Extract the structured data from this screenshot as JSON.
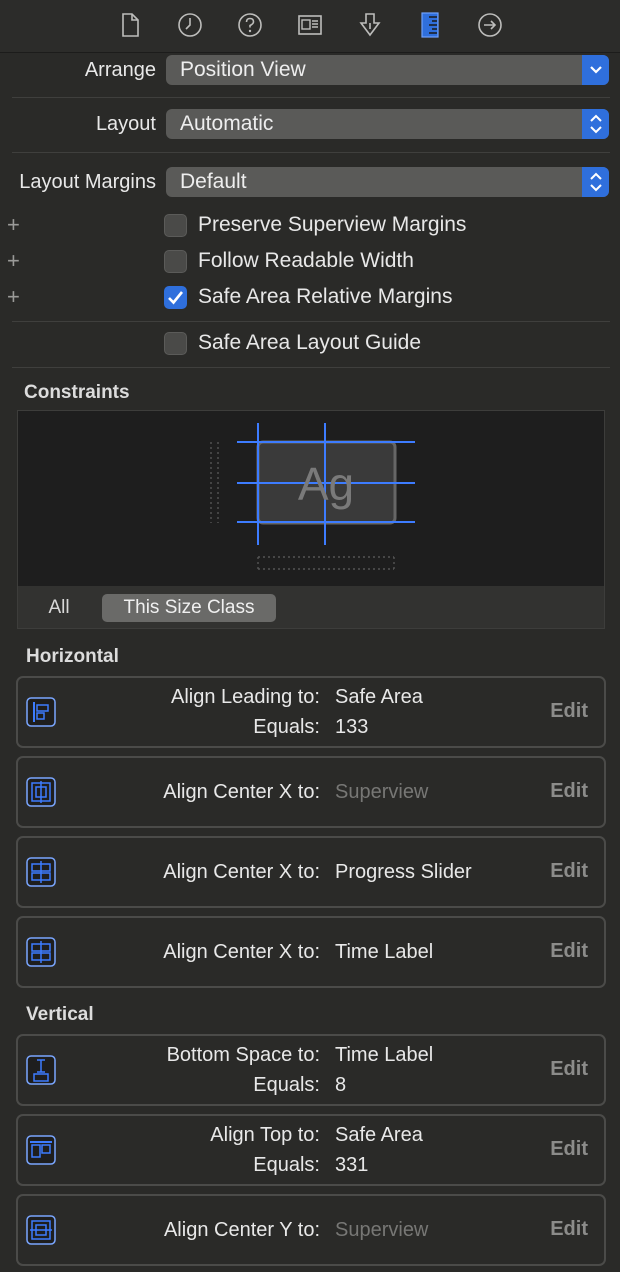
{
  "toolbar": {
    "icons": [
      "file-icon",
      "history-icon",
      "help-icon",
      "identity-icon",
      "attributes-icon",
      "size-ruler-icon",
      "connections-icon"
    ],
    "selected": "size-ruler-icon",
    "accent": "#2f6fdc"
  },
  "arrange": {
    "label": "Arrange",
    "value": "Position View"
  },
  "layout": {
    "label": "Layout",
    "value": "Automatic"
  },
  "layout_margins": {
    "label": "Layout Margins",
    "value": "Default"
  },
  "checkboxes": [
    {
      "label": "Preserve Superview Margins",
      "checked": false,
      "plus": "+"
    },
    {
      "label": "Follow Readable Width",
      "checked": false,
      "plus": "+"
    },
    {
      "label": "Safe Area Relative Margins",
      "checked": true,
      "plus": "+"
    },
    {
      "label": "Safe Area Layout Guide",
      "checked": false
    }
  ],
  "constraints": {
    "title": "Constraints",
    "preview_text": "Ag",
    "segments": [
      "All",
      "This Size Class"
    ],
    "selected_segment": "This Size Class"
  },
  "horizontal": {
    "title": "Horizontal",
    "rows": [
      {
        "icon": "align-leading-icon",
        "key": "Align Leading to:",
        "value": "Safe Area",
        "key2": "Equals:",
        "value2": "133",
        "edit": "Edit"
      },
      {
        "icon": "align-center-x-icon",
        "key": "Align Center X to:",
        "value": "Superview",
        "dim": true,
        "edit": "Edit"
      },
      {
        "icon": "align-center-x-icon",
        "key": "Align Center X to:",
        "value": "Progress Slider",
        "edit": "Edit"
      },
      {
        "icon": "align-center-x-icon",
        "key": "Align Center X to:",
        "value": "Time Label",
        "edit": "Edit"
      }
    ]
  },
  "vertical": {
    "title": "Vertical",
    "rows": [
      {
        "icon": "bottom-space-icon",
        "key": "Bottom Space to:",
        "value": "Time Label",
        "key2": "Equals:",
        "value2": "8",
        "edit": "Edit"
      },
      {
        "icon": "align-top-icon",
        "key": "Align Top to:",
        "value": "Safe Area",
        "key2": "Equals:",
        "value2": "331",
        "edit": "Edit"
      },
      {
        "icon": "align-center-y-icon",
        "key": "Align Center Y to:",
        "value": "Superview",
        "dim": true,
        "edit": "Edit"
      }
    ]
  }
}
